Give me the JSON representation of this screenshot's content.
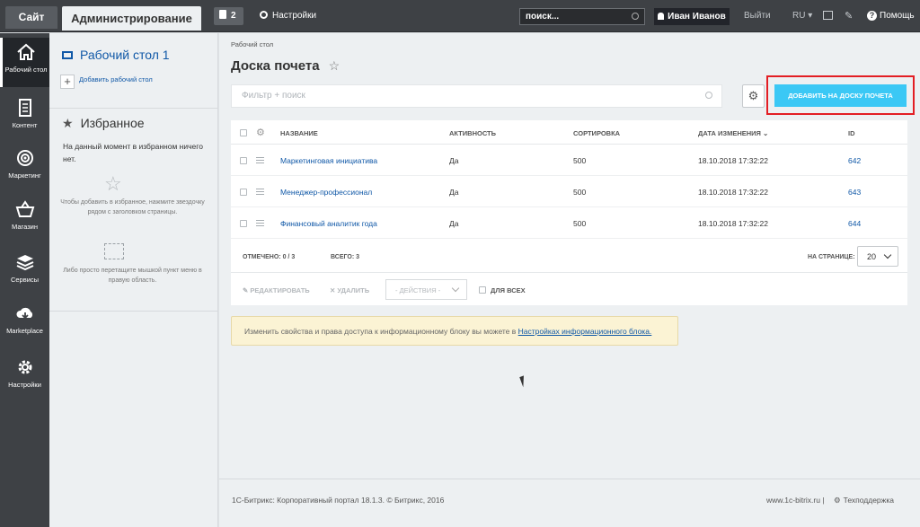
{
  "topbar": {
    "site_tab": "Сайт",
    "admin_tab": "Администрирование",
    "notifications_count": "2",
    "settings_label": "Настройки",
    "search_value": "поиск...",
    "user_name": "Иван Иванов",
    "logout_label": "Выйти",
    "lang_label": "RU",
    "help_label": "Помощь"
  },
  "leftnav": {
    "items": [
      {
        "label": "Рабочий стол",
        "icon": "home-icon"
      },
      {
        "label": "Контент",
        "icon": "document-icon"
      },
      {
        "label": "Маркетинг",
        "icon": "target-icon"
      },
      {
        "label": "Магазин",
        "icon": "basket-icon"
      },
      {
        "label": "Сервисы",
        "icon": "layers-icon"
      },
      {
        "label": "Marketplace",
        "icon": "cloud-download-icon"
      },
      {
        "label": "Настройки",
        "icon": "gear-icon"
      }
    ]
  },
  "sidebar": {
    "workspace_title": "Рабочий стол 1",
    "add_workspace": "Добавить рабочий стол",
    "favorites_title": "Избранное",
    "favorites_empty": "На данный момент в избранном ничего нет.",
    "hint_star": "Чтобы добавить в избранное, нажмите звездочку рядом с заголовком страницы.",
    "hint_drag": "Либо просто перетащите мышкой пункт меню в правую область."
  },
  "main": {
    "breadcrumb": "Рабочий стол",
    "title": "Доска почета",
    "filter_placeholder": "Фильтр + поиск",
    "add_button": "ДОБАВИТЬ НА ДОСКУ ПОЧЕТА",
    "columns": {
      "name": "НАЗВАНИЕ",
      "active": "АКТИВНОСТЬ",
      "sort": "СОРТИРОВКА",
      "modified": "ДАТА ИЗМЕНЕНИЯ",
      "id": "ID"
    },
    "rows": [
      {
        "name": "Маркетинговая инициатива",
        "active": "Да",
        "sort": "500",
        "modified": "18.10.2018 17:32:22",
        "id": "642"
      },
      {
        "name": "Менеджер-профессионал",
        "active": "Да",
        "sort": "500",
        "modified": "18.10.2018 17:32:22",
        "id": "643"
      },
      {
        "name": "Финансовый аналитик года",
        "active": "Да",
        "sort": "500",
        "modified": "18.10.2018 17:32:22",
        "id": "644"
      }
    ],
    "marked_label": "ОТМЕЧЕНО:",
    "marked_value": "0 / 3",
    "total_label": "ВСЕГО:",
    "total_value": "3",
    "per_page_label": "НА СТРАНИЦЕ:",
    "per_page_value": "20",
    "edit_label": "РЕДАКТИРОВАТЬ",
    "delete_label": "УДАЛИТЬ",
    "actions_select": "- ДЕЙСТВИЯ -",
    "for_all_label": "ДЛЯ ВСЕХ",
    "notice_text": "Изменить свойства и права доступа к информационному блоку вы можете в ",
    "notice_link": "Настройках информационного блока."
  },
  "footer": {
    "copyright": "1С-Битрикс: Корпоративный портал 18.1.3. © Битрикс, 2016",
    "site": "www.1c-bitrix.ru",
    "support": "Техподдержка"
  },
  "colors": {
    "topbar_bg": "#3e4145",
    "link": "#1058a7",
    "accent_button": "#3bc8f5",
    "highlight_border": "#e31e24",
    "notice_bg": "#fbf3d4"
  }
}
